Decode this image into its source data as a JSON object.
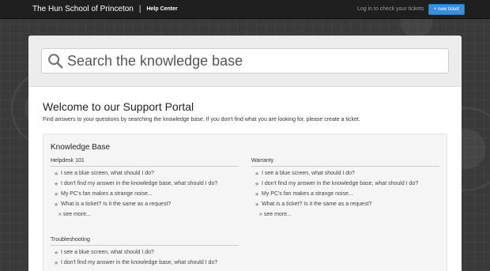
{
  "header": {
    "brand": "The Hun School of Princeton",
    "separator": "|",
    "section": "Help Center",
    "login_link": "Log in to check your tickets",
    "new_ticket_button": "+ new ticket"
  },
  "search": {
    "placeholder": "Search the knowledge base"
  },
  "welcome": {
    "title": "Welcome to our Support Portal",
    "text": "Find answers to your questions by searching the knowledge base. If you don't find what you are looking for, please create a ticket."
  },
  "knowledge_base": {
    "title": "Knowledge Base",
    "categories": [
      {
        "title": "Helpdesk 101",
        "articles": [
          "I see a blue screen, what should I do?",
          "I don't find my answer in the knowledge base, what should I do?",
          "My PC's fan makes a strange noise...",
          "What is a ticket? Is it the same as a request?"
        ],
        "see_more": "» see more..."
      },
      {
        "title": "Warranty",
        "articles": [
          "I see a blue screen, what should I do?",
          "I don't find my answer in the knowledge base, what should I do?",
          "My PC's fan makes a strange noise...",
          "What is a ticket? Is it the same as a request?"
        ],
        "see_more": "» see more..."
      },
      {
        "title": "Troubleshooting",
        "articles": [
          "I see a blue screen, what should I do?",
          "I don't find my answer in the knowledge base, what should I do?"
        ]
      }
    ]
  },
  "colors": {
    "topbar": "#1f1f1f",
    "accent": "#3b8fd9",
    "background": "#3a3a3a"
  },
  "icons": {
    "search": "search-icon",
    "article": "star-icon"
  }
}
